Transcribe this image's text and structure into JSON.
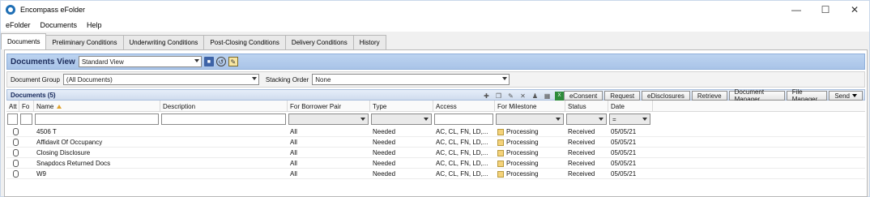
{
  "window": {
    "title": "Encompass eFolder",
    "min": "—",
    "max": "☐",
    "close": "✕"
  },
  "menu": [
    "eFolder",
    "Documents",
    "Help"
  ],
  "tabs": [
    "Documents",
    "Preliminary Conditions",
    "Underwriting Conditions",
    "Post-Closing Conditions",
    "Delivery Conditions",
    "History"
  ],
  "view": {
    "title": "Documents View",
    "selected": "Standard View"
  },
  "filters": {
    "group_label": "Document Group",
    "group_value": "(All Documents)",
    "stacking_label": "Stacking Order",
    "stacking_value": "None"
  },
  "docs": {
    "title": "Documents (5)",
    "buttons": [
      "eConsent",
      "Request",
      "eDisclosures",
      "Retrieve",
      "Document Manager",
      "File Manager",
      "Send"
    ]
  },
  "grid": {
    "headers": [
      "Att",
      "Fo",
      "Name",
      "Description",
      "For Borrower Pair",
      "Type",
      "Access",
      "For Milestone",
      "Status",
      "Date"
    ],
    "date_filter": "=",
    "rows": [
      {
        "name": "4506 T",
        "desc": "",
        "pair": "All",
        "type": "Needed",
        "access": "AC, CL, FN, LD,...",
        "milestone": "Processing",
        "status": "Received",
        "date": "05/05/21"
      },
      {
        "name": "Affidavit Of Occupancy",
        "desc": "",
        "pair": "All",
        "type": "Needed",
        "access": "AC, CL, FN, LD,...",
        "milestone": "Processing",
        "status": "Received",
        "date": "05/05/21"
      },
      {
        "name": "Closing Disclosure",
        "desc": "",
        "pair": "All",
        "type": "Needed",
        "access": "AC, CL, FN, LD,...",
        "milestone": "Processing",
        "status": "Received",
        "date": "05/05/21"
      },
      {
        "name": "Snapdocs Returned Docs",
        "desc": "",
        "pair": "All",
        "type": "Needed",
        "access": "AC, CL, FN, LD,...",
        "milestone": "Processing",
        "status": "Received",
        "date": "05/05/21"
      },
      {
        "name": "W9",
        "desc": "",
        "pair": "All",
        "type": "Needed",
        "access": "AC, CL, FN, LD,...",
        "milestone": "Processing",
        "status": "Received",
        "date": "05/05/21"
      }
    ]
  }
}
